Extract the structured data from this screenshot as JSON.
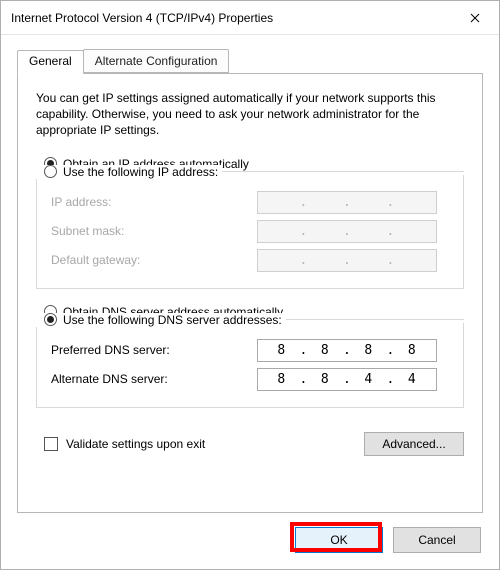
{
  "window": {
    "title": "Internet Protocol Version 4 (TCP/IPv4) Properties"
  },
  "tabs": {
    "general": "General",
    "alternate": "Alternate Configuration"
  },
  "description": "You can get IP settings assigned automatically if your network supports this capability. Otherwise, you need to ask your network administrator for the appropriate IP settings.",
  "ipSection": {
    "autoLabel": "Obtain an IP address automatically",
    "manualLabel": "Use the following IP address:",
    "selected": "auto",
    "fields": {
      "ipAddress": {
        "label": "IP address:",
        "value": [
          "",
          "",
          "",
          ""
        ]
      },
      "subnetMask": {
        "label": "Subnet mask:",
        "value": [
          "",
          "",
          "",
          ""
        ]
      },
      "gateway": {
        "label": "Default gateway:",
        "value": [
          "",
          "",
          "",
          ""
        ]
      }
    }
  },
  "dnsSection": {
    "autoLabel": "Obtain DNS server address automatically",
    "manualLabel": "Use the following DNS server addresses:",
    "selected": "manual",
    "fields": {
      "preferred": {
        "label": "Preferred DNS server:",
        "value": [
          "8",
          "8",
          "8",
          "8"
        ]
      },
      "alternate": {
        "label": "Alternate DNS server:",
        "value": [
          "8",
          "8",
          "4",
          "4"
        ]
      }
    }
  },
  "validateLabel": "Validate settings upon exit",
  "validateChecked": false,
  "buttons": {
    "advanced": "Advanced...",
    "ok": "OK",
    "cancel": "Cancel"
  }
}
